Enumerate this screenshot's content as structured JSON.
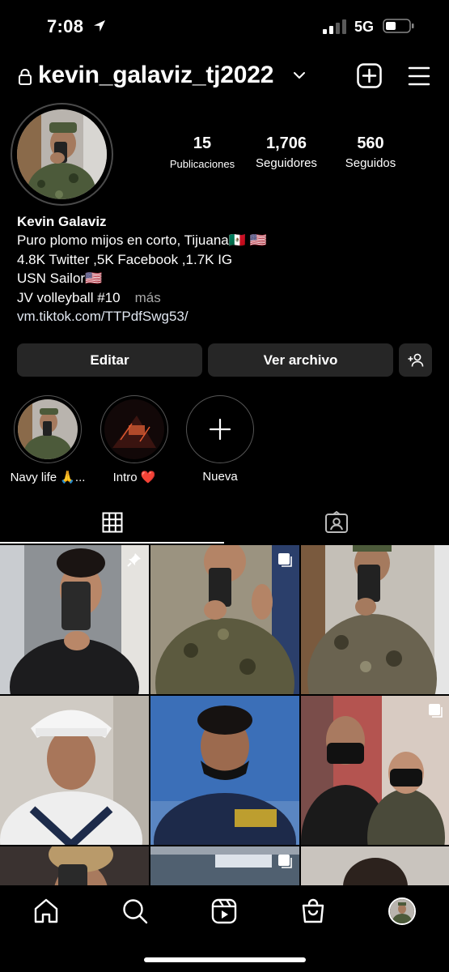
{
  "status_bar": {
    "time": "7:08",
    "network": "5G"
  },
  "header": {
    "username": "kevin_galaviz_tj2022"
  },
  "stats": [
    {
      "value": "15",
      "label": "Publicaciones"
    },
    {
      "value": "1,706",
      "label": "Seguidores"
    },
    {
      "value": "560",
      "label": "Seguidos"
    }
  ],
  "bio": {
    "name": "Kevin Galaviz",
    "lines": [
      "Puro plomo mijos en corto,  Tijuana🇲🇽 🇺🇸",
      "4.8K Twitter ,5K Facebook ,1.7K IG",
      "USN Sailor🇺🇸",
      "JV volleyball #10"
    ],
    "more": "más",
    "link": "vm.tiktok.com/TTPdfSwg53/"
  },
  "buttons": {
    "edit": "Editar",
    "archive": "Ver archivo"
  },
  "highlights": [
    {
      "label": "Navy life 🙏..."
    },
    {
      "label": "Intro ❤️"
    },
    {
      "label": "Nueva"
    }
  ],
  "icons": [
    "location-arrow-icon",
    "signal-icon",
    "battery-icon",
    "lock-icon",
    "chevron-down-icon",
    "new-post-icon",
    "menu-icon",
    "add-person-icon",
    "plus-icon",
    "grid-icon",
    "tagged-icon",
    "pin-icon",
    "multi-photo-icon",
    "home-icon",
    "search-icon",
    "reels-icon",
    "shop-icon",
    "profile-avatar"
  ],
  "grid_colors": [
    "#6b6e72",
    "#5c5a3f",
    "#6a6350",
    "#d6d2cc",
    "#3b6fb8",
    "#7a4d4a",
    "#3a3230",
    "#9aa3ae",
    "#3a2e28"
  ]
}
